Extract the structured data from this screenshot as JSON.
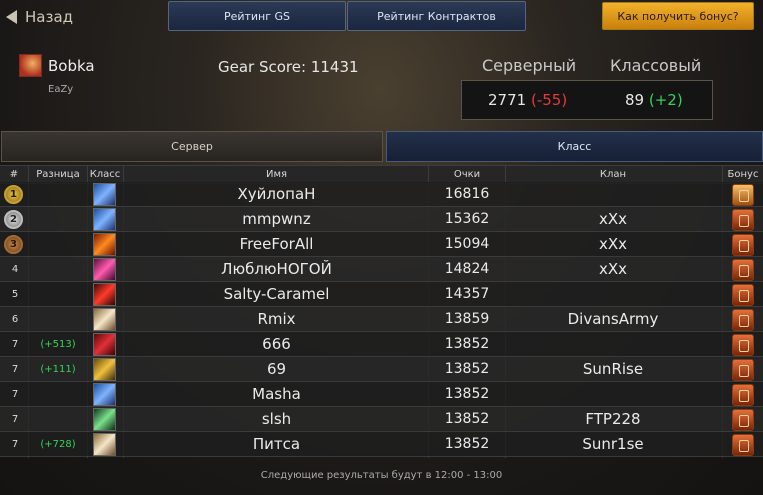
{
  "nav": {
    "back_label": "Назад"
  },
  "top_tabs": [
    {
      "label": "Рейтинг GS"
    },
    {
      "label": "Рейтинг Контрактов"
    }
  ],
  "bonus_button": {
    "label": "Как получить бонус?"
  },
  "player": {
    "name": "Bobka",
    "guild": "EaZy",
    "gear_score": "Gear Score: 11431"
  },
  "ranks": {
    "server_title": "Серверный",
    "class_title": "Классовый",
    "server_value": "2771",
    "server_change": "(-55)",
    "class_value": "89",
    "class_change": "(+2)"
  },
  "scope_tabs": {
    "server": "Сервер",
    "class": "Класс"
  },
  "table": {
    "headers": {
      "rank": "#",
      "diff": "Разница",
      "cls": "Класс",
      "name": "Имя",
      "score": "Очки",
      "clan": "Клан",
      "bonus": "Бонус"
    },
    "rows": [
      {
        "rank": "1",
        "diff": "",
        "name": "ХуйлопаН",
        "score": "16816",
        "clan": "",
        "class_icon": "class-icon-blue",
        "bonus_icon": "bonus-gold-icon"
      },
      {
        "rank": "2",
        "diff": "",
        "name": "mmpwnz",
        "score": "15362",
        "clan": "xXx",
        "class_icon": "class-icon-blue",
        "bonus_icon": "bonus-icon"
      },
      {
        "rank": "3",
        "diff": "",
        "name": "FreeForAll",
        "score": "15094",
        "clan": "xXx",
        "class_icon": "class-icon-fire",
        "bonus_icon": "bonus-icon"
      },
      {
        "rank": "4",
        "diff": "",
        "name": "ЛюблюНОГОЙ",
        "score": "14824",
        "clan": "xXx",
        "class_icon": "class-icon-pink",
        "bonus_icon": "bonus-icon"
      },
      {
        "rank": "5",
        "diff": "",
        "name": "Salty-Caramel",
        "score": "14357",
        "clan": "",
        "class_icon": "class-icon-red",
        "bonus_icon": "bonus-icon"
      },
      {
        "rank": "6",
        "diff": "",
        "name": "Rmix",
        "score": "13859",
        "clan": "DivansArmy",
        "class_icon": "class-icon-light",
        "bonus_icon": "bonus-icon"
      },
      {
        "rank": "7",
        "diff": "(+513)",
        "name": "666",
        "score": "13852",
        "clan": "",
        "class_icon": "class-icon-crimson",
        "bonus_icon": "bonus-icon"
      },
      {
        "rank": "7",
        "diff": "(+111)",
        "name": "69",
        "score": "13852",
        "clan": "SunRise",
        "class_icon": "class-icon-gold",
        "bonus_icon": "bonus-icon"
      },
      {
        "rank": "7",
        "diff": "",
        "name": "Masha",
        "score": "13852",
        "clan": "",
        "class_icon": "class-icon-blue",
        "bonus_icon": "bonus-icon"
      },
      {
        "rank": "7",
        "diff": "",
        "name": "slsh",
        "score": "13852",
        "clan": "FTP228",
        "class_icon": "class-icon-green",
        "bonus_icon": "bonus-icon"
      },
      {
        "rank": "7",
        "diff": "(+728)",
        "name": "Питса",
        "score": "13852",
        "clan": "Sunr1se",
        "class_icon": "class-icon-light",
        "bonus_icon": "bonus-icon"
      }
    ]
  },
  "footer": "Следующие результаты будут в 12:00 - 13:00",
  "colors": {
    "accent_blue": "#1b2640",
    "bonus_orange": "#f1b22b",
    "positive": "#35d35a",
    "negative": "#e33b3b"
  }
}
